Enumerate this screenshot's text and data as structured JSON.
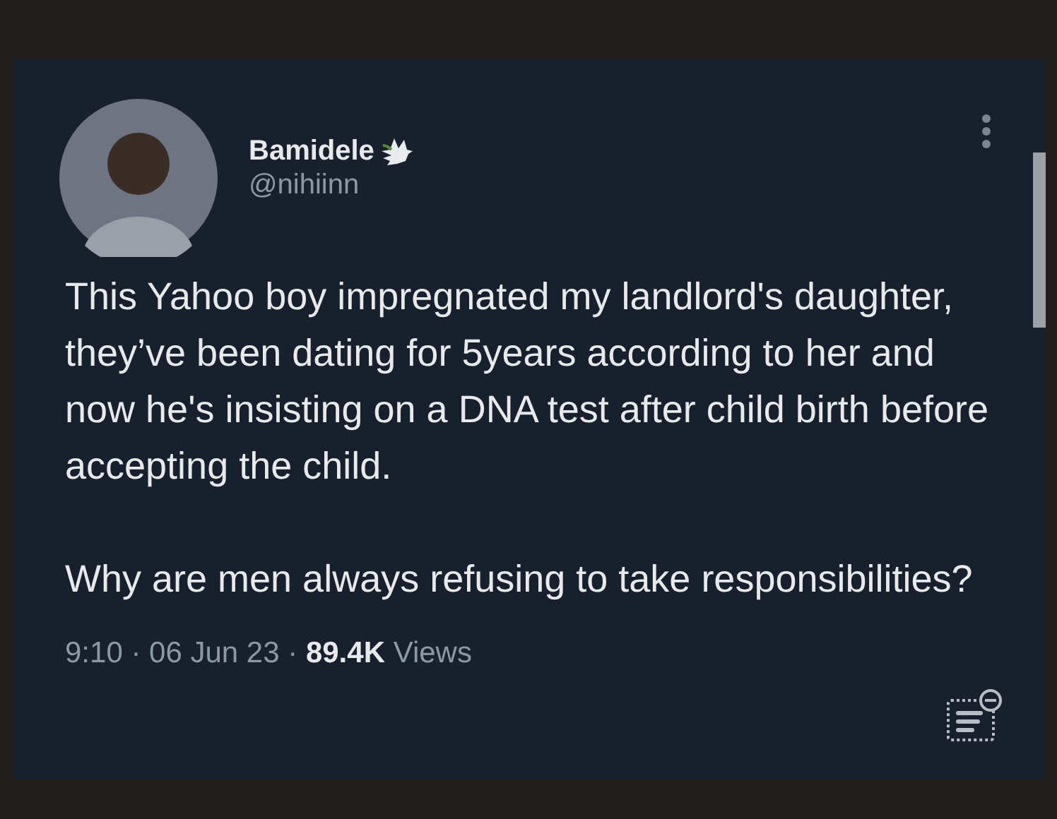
{
  "tweet": {
    "author": {
      "name": "Bamidele",
      "handle": "@nihiinn"
    },
    "paragraphs": [
      "This Yahoo boy impregnated my landlord's daughter, they’ve been dating for 5years according to her and now he's insisting on a DNA test after child birth before accepting the child.",
      "Why are men always refusing to take responsibilities?"
    ],
    "meta": "9:10 · 06 Jun 23 · **89.4K** Views"
  }
}
